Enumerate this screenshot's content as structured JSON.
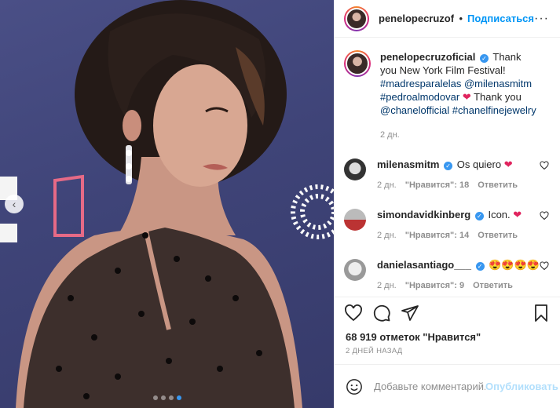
{
  "post": {
    "author": "penelopecruzoficial",
    "header_separator": "•",
    "follow_label": "Подписаться",
    "more_label": "···",
    "caption": {
      "username": "penelopecruzoficial",
      "text_before": "Thank you New York Film Festival!",
      "tag1": "#madresparalelas",
      "tag2": "@milenasmitm",
      "tag3": "#pedroalmodovar",
      "thanks": "Thank you",
      "tag4": "@chanelofficial",
      "tag5": "#chanelfinejewelry",
      "time": "2 дн."
    },
    "comments": [
      {
        "username": "milenasmitm",
        "text": "Os quiero",
        "emoji": "❤",
        "time": "2 дн.",
        "likes": "\"Нравится\": 18",
        "reply": "Ответить"
      },
      {
        "username": "simondavidkinberg",
        "text": "Icon.",
        "emoji": "❤",
        "time": "2 дн.",
        "likes": "\"Нравится\": 14",
        "reply": "Ответить"
      },
      {
        "username": "danielasantiago___",
        "text": "",
        "emoji": "😍😍😍😍",
        "time": "2 дн.",
        "likes": "\"Нравится\": 9",
        "reply": "Ответить"
      }
    ],
    "likes_text": "68 919 отметок \"Нравится\"",
    "date_text": "2 ДНЕЙ НАЗАД",
    "comment_placeholder": "Добавьте комментарий...",
    "publish_label": "Опубликовать",
    "carousel": {
      "total_slides": 4,
      "active_slide": 4
    },
    "icons": {
      "like": "heart-icon",
      "comment": "comment-icon",
      "share": "share-icon",
      "save": "bookmark-icon",
      "emoji": "smiley-icon",
      "prev": "chevron-left-icon"
    },
    "colors": {
      "link": "#00376b",
      "follow": "#0095f6",
      "heart": "#e0245e",
      "verified": "#3897f0"
    }
  }
}
